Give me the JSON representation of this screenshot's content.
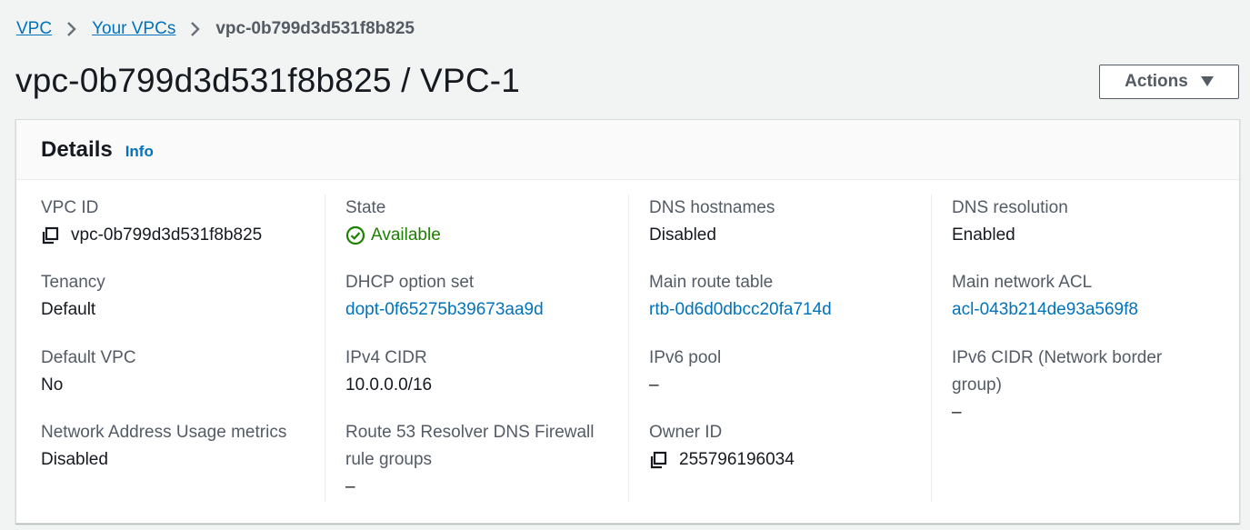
{
  "breadcrumb": {
    "items": [
      "VPC",
      "Your VPCs"
    ],
    "current": "vpc-0b799d3d531f8b825"
  },
  "page": {
    "title": "vpc-0b799d3d531f8b825 / VPC-1",
    "actions_label": "Actions"
  },
  "details": {
    "title": "Details",
    "info_label": "Info",
    "columns": [
      [
        {
          "label": "VPC ID",
          "value": "vpc-0b799d3d531f8b825",
          "copy": true
        },
        {
          "label": "Tenancy",
          "value": "Default"
        },
        {
          "label": "Default VPC",
          "value": "No"
        },
        {
          "label": "Network Address Usage metrics",
          "value": "Disabled"
        }
      ],
      [
        {
          "label": "State",
          "value": "Available",
          "status": "success"
        },
        {
          "label": "DHCP option set",
          "value": "dopt-0f65275b39673aa9d",
          "link": true
        },
        {
          "label": "IPv4 CIDR",
          "value": "10.0.0.0/16"
        },
        {
          "label_line1": "Route 53 Resolver DNS Firewall",
          "label_line2": "rule groups",
          "value": "–"
        }
      ],
      [
        {
          "label": "DNS hostnames",
          "value": "Disabled"
        },
        {
          "label": "Main route table",
          "value": "rtb-0d6d0dbcc20fa714d",
          "link": true
        },
        {
          "label": "IPv6 pool",
          "value": "–"
        },
        {
          "label": "Owner ID",
          "value": "255796196034",
          "copy": true
        }
      ],
      [
        {
          "label": "DNS resolution",
          "value": "Enabled"
        },
        {
          "label": "Main network ACL",
          "value": "acl-043b214de93a569f8",
          "link": true
        },
        {
          "label_line1": "IPv6 CIDR (Network border",
          "label_line2": "group)",
          "value": "–"
        }
      ]
    ]
  },
  "icons": {
    "breadcrumb_separator": "chevron-right-icon",
    "actions_caret": "caret-down-icon",
    "copy": "copy-icon",
    "status_ok": "check-circle-icon"
  },
  "colors": {
    "link": "#0073bb",
    "success": "#1d8102",
    "background": "#f2f3f3"
  }
}
